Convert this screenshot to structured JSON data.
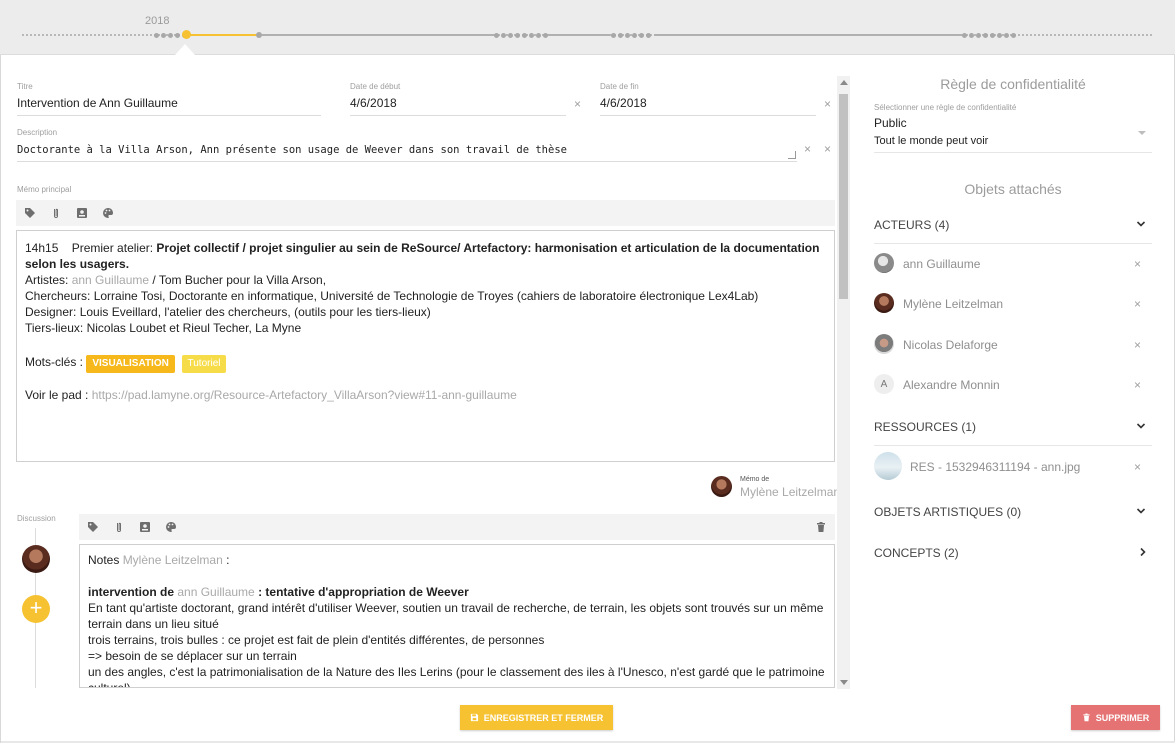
{
  "timeline": {
    "year": "2018"
  },
  "form": {
    "title": {
      "label": "Titre",
      "value": "Intervention de Ann Guillaume"
    },
    "start_date": {
      "label": "Date de début",
      "value": "4/6/2018"
    },
    "end_date": {
      "label": "Date de fin",
      "value": "4/6/2018"
    },
    "description": {
      "label": "Description",
      "value": "Doctorante à la Villa Arson, Ann présente son usage de Weever dans son travail de thèse"
    },
    "clear_glyph": "×"
  },
  "memo": {
    "label": "Mémo principal",
    "time": "14h15",
    "heading_prefix": "Premier atelier: ",
    "heading_bold": "Projet collectif / projet singulier au sein de ReSource/ Artefactory: harmonisation et articulation de la documentation selon les usagers.",
    "artists_prefix": "Artistes: ",
    "artists_link": "ann Guillaume",
    "artists_rest": " / Tom Bucher pour la Villa Arson,",
    "line_researchers": "Chercheurs: Lorraine Tosi, Doctorante en informatique, Université de Technologie de Troyes (cahiers de laboratoire électronique Lex4Lab)",
    "line_designer": "Designer: Louis Eveillard, l'atelier des chercheurs, (outils pour les tiers-lieux)",
    "line_tiers": "Tiers-lieux: Nicolas Loubet et Rieul Techer, La Myne",
    "keywords_label": "Mots-clés : ",
    "tag1": "VISUALISATION",
    "tag2": "Tutoriel",
    "pad_label": "Voir le pad : ",
    "pad_url": "https://pad.lamyne.org/Resource-Artefactory_VillaArson?view#11-ann-guillaume",
    "author_caption": "Mémo de",
    "author_name": "Mylène Leitzelman"
  },
  "discussion": {
    "label": "Discussion",
    "notes_prefix": "Notes ",
    "notes_author": "Mylène Leitzelman",
    "notes_colon": " :",
    "intervention_prefix": "intervention de ",
    "intervention_person": "ann Guillaume",
    "intervention_rest": "  : tentative d'appropriation de Weever",
    "line1": "En tant qu'artiste doctorant, grand intérêt d'utiliser Weever, soutien un travail de recherche, de terrain, les objets sont trouvés sur un même terrain dans un lieu situé",
    "line2": "trois terrains, trois bulles : ce projet est fait de plein d'entités différentes, de personnes",
    "line3": "=> besoin de se déplacer sur un terrain",
    "line4": "un des angles, c'est la patrimonialisation de la Nature des Iles Lerins (pour le classement des iles à l'Unesco, n'est gardé que le patrimoine culturel)",
    "add_glyph": "+"
  },
  "privacy": {
    "heading": "Règle de confidentialité",
    "select_label": "Sélectionner une règle de confidentialité",
    "value": "Public",
    "sub": "Tout le monde peut voir"
  },
  "attached": {
    "heading": "Objets attachés",
    "actors_title": "ACTEURS (4)",
    "actors": [
      {
        "name": "ann Guillaume"
      },
      {
        "name": "Mylène Leitzelman"
      },
      {
        "name": "Nicolas Delaforge"
      },
      {
        "name": "Alexandre Monnin",
        "initial": "A"
      }
    ],
    "resources_title": "RESSOURCES (1)",
    "resources": [
      {
        "name": "RES - 1532946311194 - ann.jpg"
      }
    ],
    "artistic_title": "OBJETS ARTISTIQUES (0)",
    "concepts_title": "CONCEPTS (2)"
  },
  "actions": {
    "save": "ENREGISTRER ET FERMER",
    "delete": "SUPPRIMER"
  },
  "colors": {
    "accent": "#f6c231",
    "danger": "#e57373"
  }
}
